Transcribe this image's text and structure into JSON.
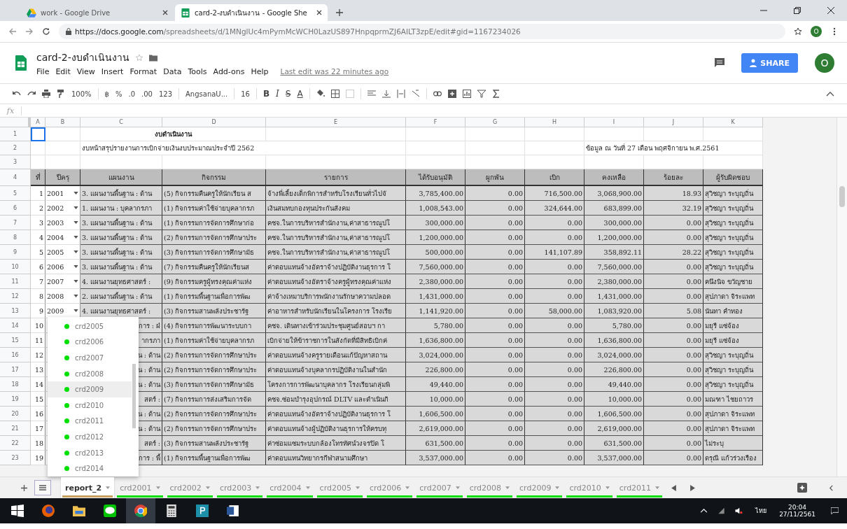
{
  "browser": {
    "tabs": [
      {
        "title": "work - Google Drive",
        "selected": false,
        "kind": "drive"
      },
      {
        "title": "card-2-งบดำเนินงาน - Google She",
        "selected": true,
        "kind": "sheets"
      }
    ],
    "url_host": "https://docs.google.com",
    "url_path": "/spreadsheets/d/1MNglUc4mPymMcWCH0LazUS897HnpqprmZJ6AILT3zpE/edit#gid=1167234026",
    "avatar": "O"
  },
  "doc": {
    "title": "card-2-งบดำเนินงาน",
    "menus": [
      "File",
      "Edit",
      "View",
      "Insert",
      "Format",
      "Data",
      "Tools",
      "Add-ons",
      "Help"
    ],
    "last_edit": "Last edit was 22 minutes ago",
    "share": "SHARE",
    "avatar": "O"
  },
  "toolbar": {
    "zoom": "100%",
    "currency": "฿",
    "percent": "%",
    "dec_less": ".0",
    "dec_more": ".00",
    "number_format": "123",
    "font": "AngsanaU...",
    "font_size": "16",
    "bold": "B",
    "italic": "I",
    "strike": "S",
    "text_color": "A"
  },
  "formula_bar": {
    "label": "fx"
  },
  "grid": {
    "columns": [
      "A",
      "B",
      "C",
      "D",
      "E",
      "F",
      "G",
      "H",
      "I",
      "J",
      "K"
    ],
    "row_numbers": [
      "1",
      "2",
      "3",
      "4",
      "5",
      "6",
      "7",
      "8",
      "9",
      "10",
      "11",
      "12",
      "13",
      "14",
      "15",
      "16",
      "17",
      "18",
      "19",
      "20",
      "21",
      "22",
      "23"
    ],
    "title": "งบดำเนินงาน",
    "subtitle": "งบหน้าสรุปรายงานการเบิกจ่ายเงินงบประมาณประจำปี 2562",
    "date_note": "ข้อมูล ณ วันที่ 27 เดือน พฤศจิกายน พ.ศ.2561",
    "header": [
      "ที่",
      "ปีครุ",
      "แผนงาน",
      "กิจกรรม",
      "รายการ",
      "ได้รับอนุมัติ",
      "ผูกพัน",
      "เบิก",
      "คงเหลือ",
      "ร้อยละ",
      "ผู้รับผิดชอบ"
    ],
    "rows": [
      {
        "no": "1",
        "code": "2001",
        "plan": "3. แผนงานพื้นฐาน : ด้าน",
        "activity": "(5) กิจกรรมคืนครูให้นักเรียน ส",
        "item": "จ้างพี่เลี้ยงเด็กพิการสำหรับโรงเรียนทั่วไปจั",
        "approved": "3,785,400.00",
        "committed": "0.00",
        "disbursed": "716,500.00",
        "remaining": "3,068,900.00",
        "percent": "18.93",
        "owner": "สุวิชญา ระบุญถิ่น"
      },
      {
        "no": "2",
        "code": "2002",
        "plan": "1. แผนงาน : บุคลากรภา",
        "activity": "(1) กิจกรรมค่าใช้จ่ายบุคลากรภ",
        "item": "เงินสมทบกองทุนประกันสังคม",
        "approved": "1,008,543.00",
        "committed": "0.00",
        "disbursed": "324,644.00",
        "remaining": "683,899.00",
        "percent": "32.19",
        "owner": "สุวิชญา ระบุญถิ่น"
      },
      {
        "no": "3",
        "code": "2003",
        "plan": "3. แผนงานพื้นฐาน : ด้าน",
        "activity": "(1) กิจกรรมการจัดการศึกษาก่อ",
        "item": "คชจ.ในการบริหารสำนักงาน,ค่าสาธารณูปโ",
        "approved": "300,000.00",
        "committed": "0.00",
        "disbursed": "0.00",
        "remaining": "300,000.00",
        "percent": "0.00",
        "owner": "สุวิชญา ระบุญถิ่น"
      },
      {
        "no": "4",
        "code": "2004",
        "plan": "3. แผนงานพื้นฐาน : ด้าน",
        "activity": "(2) กิจกรรมการจัดการศึกษาประ",
        "item": "คชจ.ในการบริหารสำนักงาน,ค่าสาธารณูปโ",
        "approved": "1,200,000.00",
        "committed": "0.00",
        "disbursed": "0.00",
        "remaining": "1,200,000.00",
        "percent": "0.00",
        "owner": "สุวิชญา ระบุญถิ่น"
      },
      {
        "no": "5",
        "code": "2005",
        "plan": "3. แผนงานพื้นฐาน : ด้าน",
        "activity": "(3) กิจกรรมการจัดการศึกษามัธ",
        "item": "คชจ.ในการบริหารสำนักงาน,ค่าสาธารณูปโ",
        "approved": "500,000.00",
        "committed": "0.00",
        "disbursed": "141,107.89",
        "remaining": "358,892.11",
        "percent": "28.22",
        "owner": "สุวิชญา ระบุญถิ่น"
      },
      {
        "no": "6",
        "code": "2006",
        "plan": "3. แผนงานพื้นฐาน : ด้าน",
        "activity": "(7) กิจกรรมคืนครูให้นักเรียนส",
        "item": "ค่าตอบแทนจ้างอัตราจ้างปฏิบัติงานธุรการ โ",
        "approved": "7,560,000.00",
        "committed": "0.00",
        "disbursed": "0.00",
        "remaining": "7,560,000.00",
        "percent": "0.00",
        "owner": "สุวิชญา ระบุญถิ่น"
      },
      {
        "no": "7",
        "code": "2007",
        "plan": "4. แผนงานยุทธศาสตร์ :",
        "activity": "(9) กิจกรรมครูผู้ทรงคุณค่าแห่ง",
        "item": "ค่าตอบแทนจ้างอัตราจ้างครูผู้ทรงคุณค่าแห่ง",
        "approved": "2,380,000.00",
        "committed": "0.00",
        "disbursed": "0.00",
        "remaining": "2,380,000.00",
        "percent": "0.00",
        "owner": "คนึงนิจ ขวัญชาย"
      },
      {
        "no": "8",
        "code": "2008",
        "plan": "2. แผนงานพื้นฐาน : ด้าน",
        "activity": "(1) กิจกรรมพื้นฐานเพื่อการพัฒ",
        "item": "ค่าจ้างเหมาบริการพนักงานรักษาความปลอด",
        "approved": "1,431,000.00",
        "committed": "0.00",
        "disbursed": "0.00",
        "remaining": "1,431,000.00",
        "percent": "0.00",
        "owner": "สุปภาดา จิระแพท"
      },
      {
        "no": "9",
        "code": "2009",
        "plan": "4. แผนงานยุทธศาสตร์ :",
        "activity": "(3) กิจกรรมสานพลังประชารัฐ",
        "item": "ค่าอาหารสำหรับนักเรียนในโครงการ โรงเรีย",
        "approved": "1,141,920.00",
        "committed": "0.00",
        "disbursed": "58,000.00",
        "remaining": "1,083,920.00",
        "percent": "5.08",
        "owner": "นันทา คำทอง"
      },
      {
        "no": "10",
        "plan": "การ : ฝ่",
        "activity": "(4) กิจกรรมการพัฒนาระบบกา",
        "item": "คชจ. เดินทางเข้าร่วมประชุมศูนย์สอบฯ กา",
        "approved": "5,780.00",
        "committed": "0.00",
        "disbursed": "0.00",
        "remaining": "5,780.00",
        "percent": "0.00",
        "owner": "มยุรี แซ่จ้อง"
      },
      {
        "no": "11",
        "plan": "ากรภา",
        "activity": "(1) กิจกรรมค่าใช้จ่ายบุคลากรภ",
        "item": "เบิกจ่ายให้ข้าราชการในสังกัดที่มีสิทธิเบิกค่",
        "approved": "1,636,800.00",
        "committed": "0.00",
        "disbursed": "0.00",
        "remaining": "1,636,800.00",
        "percent": "0.00",
        "owner": "มยุรี แซ่จ้อง"
      },
      {
        "no": "12",
        "plan": "น : ด้าน",
        "activity": "(2) กิจกรรมการจัดการศึกษาประ",
        "item": "ค่าตอบแทนจ้างครูรายเดือนแก้ปัญหาสถาน",
        "approved": "3,024,000.00",
        "committed": "0.00",
        "disbursed": "0.00",
        "remaining": "3,024,000.00",
        "percent": "0.00",
        "owner": "สุวิชญา ระบุญถิ่น"
      },
      {
        "no": "13",
        "plan": "น : ด้าน",
        "activity": "(2) กิจกรรมการจัดการศึกษาประ",
        "item": "ค่าตอบแทนจ้างบุคลากรปฏิบัติงานในสำนัก",
        "approved": "226,800.00",
        "committed": "0.00",
        "disbursed": "0.00",
        "remaining": "226,800.00",
        "percent": "0.00",
        "owner": "สุวิชญา ระบุญถิ่น"
      },
      {
        "no": "14",
        "plan": "น : ด้าน",
        "activity": "(3) กิจกรรมการจัดการศึกษามัธ",
        "item": "โครงการการพัฒนาบุคลากร โรงเรียนกลุ่มพิ",
        "approved": "49,440.00",
        "committed": "0.00",
        "disbursed": "0.00",
        "remaining": "49,440.00",
        "percent": "0.00",
        "owner": "สุวิชญา ระบุญถิ่น"
      },
      {
        "no": "15",
        "plan": "สตร์ :",
        "activity": "(7) กิจกรรมการส่งเสริมการจัด",
        "item": "คชจ.ซ่อมบำรุงอุปกรณ์ DLTV และดำเนินกิ",
        "approved": "10,000.00",
        "committed": "0.00",
        "disbursed": "0.00",
        "remaining": "10,000.00",
        "percent": "0.00",
        "owner": "มณฑา ไชยถาวร"
      },
      {
        "no": "16",
        "plan": "น : ด้าน",
        "activity": "(2) กิจกรรมการจัดการศึกษาประ",
        "item": "ค่าตอบแทนจ้างอัตราจ้างปฏิบัติงานธุรการ โ",
        "approved": "1,606,500.00",
        "committed": "0.00",
        "disbursed": "0.00",
        "remaining": "1,606,500.00",
        "percent": "0.00",
        "owner": "สุปภาดา จิระแพท"
      },
      {
        "no": "17",
        "plan": "น : ด้าน",
        "activity": "(2) กิจกรรมการจัดการศึกษาประ",
        "item": "ค่าตอบแทนจ้างผู้ปฏิบัติงานธุรการให้ครบทุ",
        "approved": "2,619,000.00",
        "committed": "0.00",
        "disbursed": "0.00",
        "remaining": "2,619,000.00",
        "percent": "0.00",
        "owner": "สุปภาดา จิระแพท"
      },
      {
        "no": "18",
        "plan": "สตร์ :",
        "activity": "(3) กิจกรรมสานพลังประชารัฐ",
        "item": "ค่าซ่อมแซมระบบกล้องโทรทัศน์วงจรปิด โ",
        "approved": "631,500.00",
        "committed": "0.00",
        "disbursed": "0.00",
        "remaining": "631,500.00",
        "percent": "0.00",
        "owner": "ไม่ระบุ"
      },
      {
        "no": "19",
        "plan": "การ : พื้",
        "activity": "(1) กิจกรรมพื้นฐานเพื่อการพัฒ",
        "item": "ค่าตอบแทนวิทยากรกีฬาสนามศึกษา",
        "approved": "3,537,000.00",
        "committed": "0.00",
        "disbursed": "0.00",
        "remaining": "3,537,000.00",
        "percent": "0.00",
        "owner": "ดรุณี แก้วร่วงเรือง"
      }
    ]
  },
  "dropdown": {
    "items": [
      {
        "label": "crd2005",
        "selected": false,
        "color": "#00e000"
      },
      {
        "label": "crd2006",
        "selected": false,
        "color": "#00e000"
      },
      {
        "label": "crd2007",
        "selected": false,
        "color": "#00e000"
      },
      {
        "label": "crd2008",
        "selected": false,
        "color": "#00e000"
      },
      {
        "label": "crd2009",
        "selected": true,
        "color": "#00e000"
      },
      {
        "label": "crd2010",
        "selected": false,
        "color": "#00e000"
      },
      {
        "label": "crd2011",
        "selected": false,
        "color": "#00e000"
      },
      {
        "label": "crd2012",
        "selected": false,
        "color": "#00e000"
      },
      {
        "label": "crd2013",
        "selected": false,
        "color": "#00e000"
      },
      {
        "label": "crd2014",
        "selected": false,
        "color": "#00e000"
      }
    ]
  },
  "sheet_tabs": [
    {
      "label": "report_2",
      "selected": true,
      "color": "#c8a060"
    },
    {
      "label": "crd2001",
      "selected": false,
      "color": "#00e000"
    },
    {
      "label": "crd2002",
      "selected": false,
      "color": "#00e000"
    },
    {
      "label": "crd2003",
      "selected": false,
      "color": "#00e000"
    },
    {
      "label": "crd2004",
      "selected": false,
      "color": "#00e000"
    },
    {
      "label": "crd2005",
      "selected": false,
      "color": "#00e000"
    },
    {
      "label": "crd2006",
      "selected": false,
      "color": "#00e000"
    },
    {
      "label": "crd2007",
      "selected": false,
      "color": "#00e000"
    },
    {
      "label": "crd2008",
      "selected": false,
      "color": "#00e000"
    },
    {
      "label": "crd2009",
      "selected": false,
      "color": "#00e000"
    },
    {
      "label": "crd2010",
      "selected": false,
      "color": "#00e000"
    },
    {
      "label": "crd2011",
      "selected": false,
      "color": "#00e000"
    }
  ],
  "taskbar": {
    "language": "ไทย",
    "time": "20:04",
    "date": "27/11/2561"
  }
}
